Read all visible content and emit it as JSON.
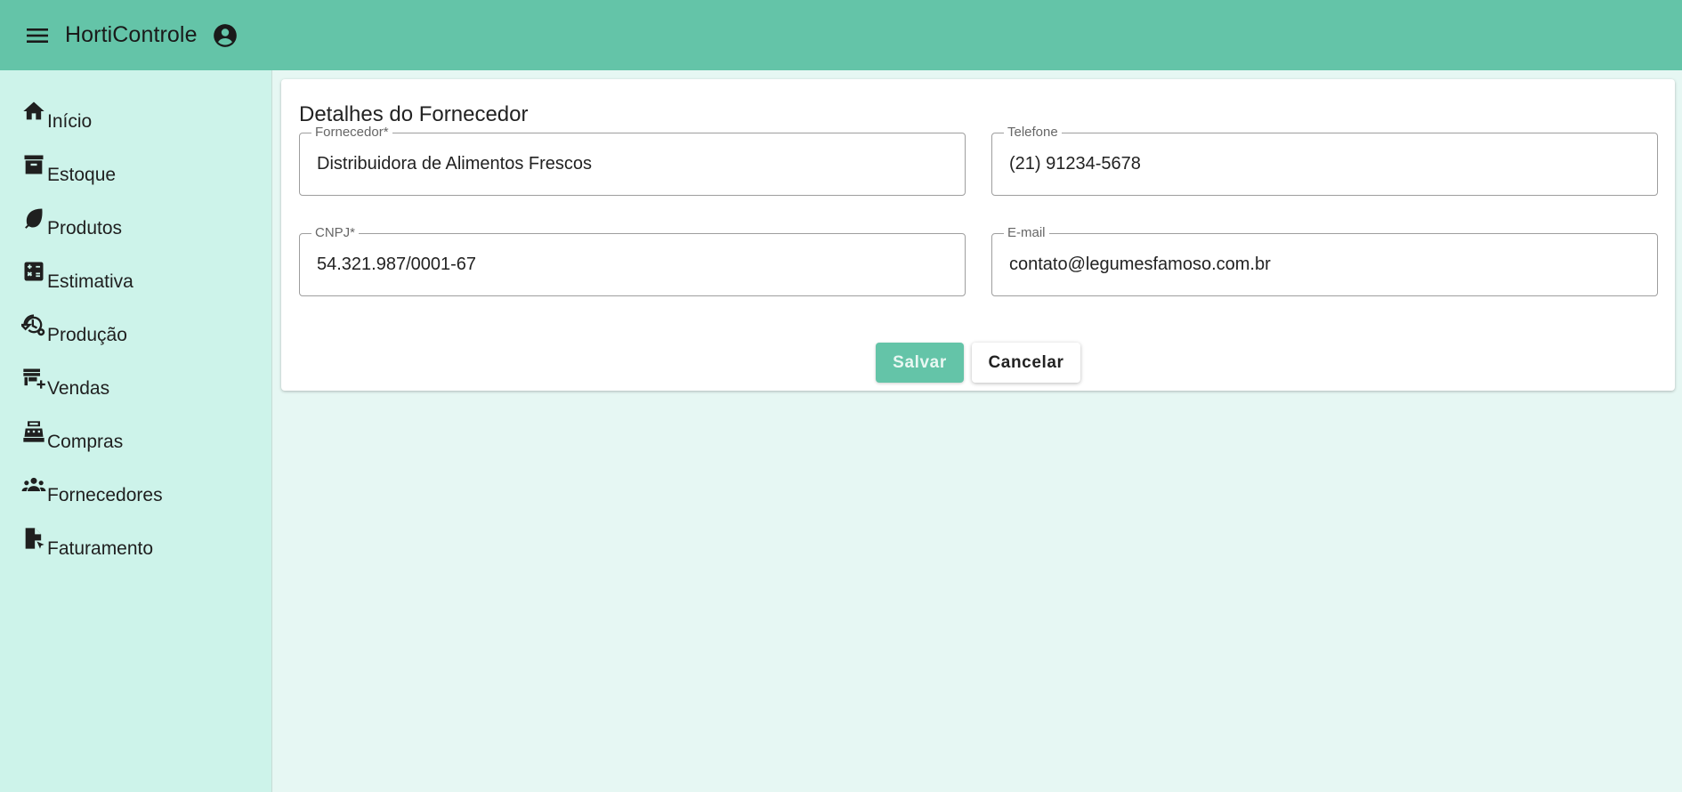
{
  "app": {
    "title": "HortiControle",
    "menu_icon": "menu-icon",
    "account_icon": "account-circle-icon",
    "header_color": "#64c4a8"
  },
  "sidebar": {
    "items": [
      {
        "label": "Início",
        "icon": "home-icon"
      },
      {
        "label": "Estoque",
        "icon": "archive-box-icon"
      },
      {
        "label": "Produtos",
        "icon": "leaf-icon"
      },
      {
        "label": "Estimativa",
        "icon": "calculator-icon"
      },
      {
        "label": "Produção",
        "icon": "history-settings-icon"
      },
      {
        "label": "Vendas",
        "icon": "store-add-icon"
      },
      {
        "label": "Compras",
        "icon": "cash-register-icon"
      },
      {
        "label": "Fornecedores",
        "icon": "group-icon"
      },
      {
        "label": "Faturamento",
        "icon": "document-cursor-icon"
      }
    ]
  },
  "form": {
    "title": "Detalhes do Fornecedor",
    "fields": {
      "fornecedor": {
        "label": "Fornecedor*",
        "value": "Distribuidora de Alimentos Frescos"
      },
      "telefone": {
        "label": "Telefone",
        "value": "(21) 91234-5678"
      },
      "cnpj": {
        "label": "CNPJ*",
        "value": "54.321.987/0001-67"
      },
      "email": {
        "label": "E-mail",
        "value": "contato@legumesfamoso.com.br"
      }
    },
    "actions": {
      "save_label": "Salvar",
      "cancel_label": "Cancelar"
    }
  }
}
